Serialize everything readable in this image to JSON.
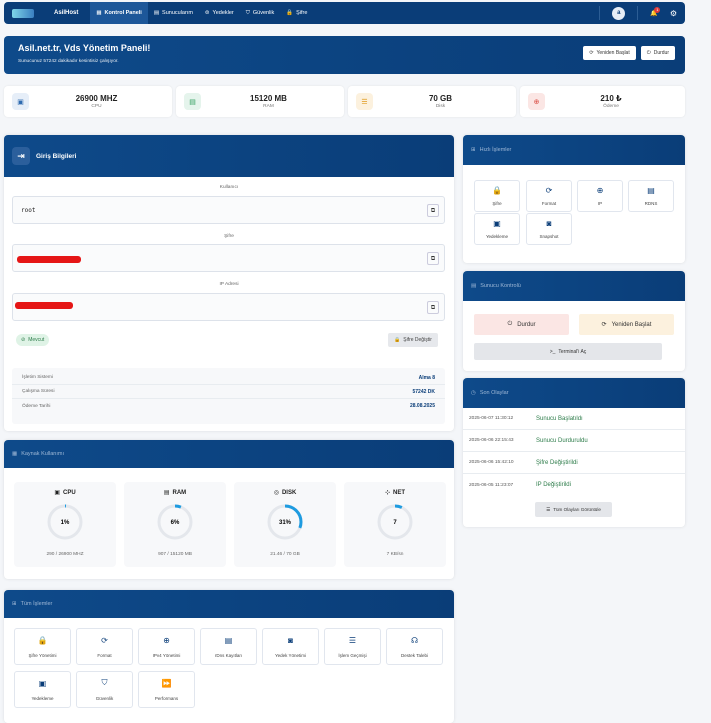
{
  "nav": {
    "brand": "AsilHost",
    "items": [
      {
        "label": "Kontrol Paneli",
        "icon": "dashboard-icon"
      },
      {
        "label": "Sunucularım",
        "icon": "server-icon"
      },
      {
        "label": "Yedekler",
        "icon": "backup-icon"
      },
      {
        "label": "Güvenlik",
        "icon": "shield-icon"
      },
      {
        "label": "Şifre",
        "icon": "lock-icon"
      }
    ],
    "avatar": "a",
    "notif_count": "1"
  },
  "welcome": {
    "title": "Asil.net.tr, Vds Yönetim Paneli!",
    "subtitle": "Sunucunuz 57242 dakikadır kesintisiz çalışıyor.",
    "restart": "Yeniden Başlat",
    "stop": "Durdur"
  },
  "stats": [
    {
      "value": "26900 MHZ",
      "label": "CPU",
      "icon": "cpu-icon",
      "color": "#2f6bb0"
    },
    {
      "value": "15120 MB",
      "label": "RAM",
      "icon": "memory-icon",
      "color": "#2f9e5d"
    },
    {
      "value": "70 GB",
      "label": "Disk",
      "icon": "database-icon",
      "color": "#e09a1e"
    },
    {
      "value": "210 ₺",
      "label": "Ödeme",
      "icon": "globe-icon",
      "color": "#d9453c"
    }
  ],
  "login": {
    "title": "Giriş Bilgileri",
    "user_label": "Kullanıcı",
    "user_value": "root",
    "pass_label": "Şifre",
    "ip_label": "IP Adresi",
    "status": "Mevcut",
    "change_pass": "Şifre Değiştir",
    "rows": [
      {
        "k": "İşletim Sistemi",
        "v": "Alma 8"
      },
      {
        "k": "Çalışma Süresi",
        "v": "57242 DK"
      },
      {
        "k": "Ödeme Tarihi",
        "v": "28.08.2025"
      }
    ]
  },
  "resources": {
    "title": "Kaynak Kullanımı",
    "items": [
      {
        "name": "CPU",
        "percent": 1,
        "pct_label": "1%",
        "detail": "290 / 26900 MHZ",
        "icon": "cpu-icon"
      },
      {
        "name": "RAM",
        "percent": 6,
        "pct_label": "6%",
        "detail": "907 / 15120 MB",
        "icon": "memory-icon"
      },
      {
        "name": "DISK",
        "percent": 31,
        "pct_label": "31%",
        "detail": "21.46 / 70 GB",
        "icon": "disk-icon"
      },
      {
        "name": "NET",
        "percent": 7,
        "pct_label": "7",
        "detail": "7 KB/sn",
        "icon": "network-icon"
      }
    ]
  },
  "quick": {
    "title": "Hızlı İşlemler",
    "items": [
      {
        "label": "Şifre",
        "icon": "lock-icon",
        "glyph": "🔒"
      },
      {
        "label": "Format",
        "icon": "refresh-icon",
        "glyph": "⟳"
      },
      {
        "label": "IP",
        "icon": "globe-icon",
        "glyph": "⊕"
      },
      {
        "label": "RDNS",
        "icon": "window-icon",
        "glyph": "▤"
      },
      {
        "label": "Yedekleme",
        "icon": "image-icon",
        "glyph": "▣"
      },
      {
        "label": "Snapshot",
        "icon": "camera-icon",
        "glyph": "◙"
      }
    ]
  },
  "control": {
    "title": "Sunucu Kontrolü",
    "stop": "Durdur",
    "restart": "Yeniden Başlat",
    "terminal": "Terminal'i Aç"
  },
  "events": {
    "title": "Son Olaylar",
    "items": [
      {
        "time": "2025-06-07 11:30:12",
        "name": "Sunucu Başlatıldı"
      },
      {
        "time": "2025-06-06 22:15:43",
        "name": "Sunucu Durduruldu"
      },
      {
        "time": "2025-06-06 15:42:10",
        "name": "Şifre Değiştirildi"
      },
      {
        "time": "2025-06-05 11:23:07",
        "name": "IP Değiştirildi"
      }
    ],
    "view_all": "Tüm Olayları Görüntüle"
  },
  "all_ops": {
    "title": "Tüm İşlemler",
    "items": [
      {
        "label": "Şifre Yönetimi",
        "icon": "lock-icon",
        "glyph": "🔒"
      },
      {
        "label": "Format",
        "icon": "refresh-icon",
        "glyph": "⟳"
      },
      {
        "label": "IPv4 Yönetimi",
        "icon": "globe-icon",
        "glyph": "⊕"
      },
      {
        "label": "rDns Kayıtları",
        "icon": "window-icon",
        "glyph": "▤"
      },
      {
        "label": "Yedek Yönetimi",
        "icon": "camera-icon",
        "glyph": "◙"
      },
      {
        "label": "İşlem Geçmişi",
        "icon": "document-icon",
        "glyph": "☰"
      },
      {
        "label": "Destek Talebi",
        "icon": "headset-icon",
        "glyph": "☊"
      },
      {
        "label": "Yedekleme",
        "icon": "image-icon",
        "glyph": "▣"
      },
      {
        "label": "Güvenlik",
        "icon": "shield-icon",
        "glyph": "⛉"
      },
      {
        "label": "Performans",
        "icon": "fast-forward-icon",
        "glyph": "⏩"
      }
    ]
  }
}
